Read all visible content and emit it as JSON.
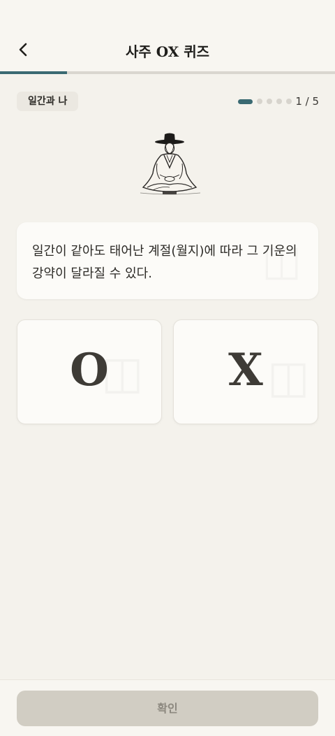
{
  "header": {
    "title": "사주 OX 퀴즈",
    "back_icon": "chevron-left-icon"
  },
  "progress": {
    "fraction": 0.2,
    "current_step": 1,
    "total_steps": 5,
    "counter_label": "1 / 5"
  },
  "category": "일간과 나",
  "illustration": {
    "icon": "seated-scholar-illustration"
  },
  "question": {
    "text": "일간이 같아도 태어난 계절(월지)에 따라 그 기운의 강약이 달라질 수 있다."
  },
  "answers": {
    "o_label": "O",
    "x_label": "X"
  },
  "footer": {
    "confirm_label": "확인"
  },
  "colors": {
    "accent": "#3a6a72",
    "background": "#f4f2ec",
    "card": "#fcfbf8",
    "button_disabled": "#d1cdc3"
  }
}
